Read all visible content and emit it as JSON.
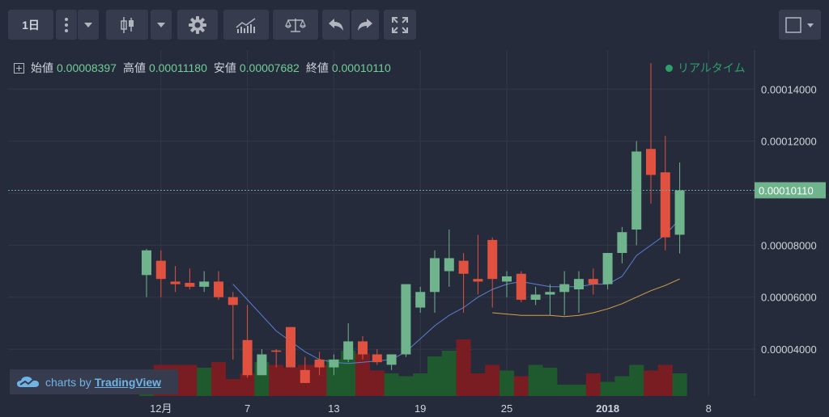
{
  "toolbar": {
    "interval_label": "1日",
    "menu_icon": "vertical-dots-icon",
    "dropdown_icon": "chevron-down-icon",
    "chart_type_icon": "candlestick-icon",
    "settings_icon": "gear-icon",
    "indicators_icon": "indicators-icon",
    "compare_icon": "balance-scale-icon",
    "undo_icon": "undo-arrow-icon",
    "redo_icon": "redo-arrow-icon",
    "fullscreen_icon": "fullscreen-icon",
    "window_icon": "square-icon"
  },
  "legend": {
    "open_label": "始値",
    "open_value": "0.00008397",
    "high_label": "高値",
    "high_value": "0.00011180",
    "low_label": "安値",
    "low_value": "0.00007682",
    "close_label": "終値",
    "close_value": "0.00010110",
    "realtime_label": "リアルタイム"
  },
  "watermark": {
    "prefix": "charts by",
    "brand": "TradingView",
    "icon": "tradingview-cloud-icon"
  },
  "colors": {
    "background": "#262b3b",
    "grid": "#323848",
    "up": "#6fb48c",
    "down": "#e0513f",
    "vol_up": "#1e5a2d",
    "vol_down": "#7a1d22",
    "ma_fast": "#5b7fd1",
    "ma_slow": "#d4a24a",
    "price_tag": "#6fb48c",
    "axis_text": "#d1d4dc"
  },
  "chart_data": {
    "type": "candlestick",
    "title": "",
    "current_price": "0.00010110",
    "ylim": [
      2.2e-05,
      0.000155
    ],
    "y_ticks": [
      "0.00004000",
      "0.00006000",
      "0.00008000",
      "0.00010000",
      "0.00012000",
      "0.00014000"
    ],
    "x_ticks": [
      {
        "index": 1,
        "label": "12月",
        "bold": false
      },
      {
        "index": 7,
        "label": "7",
        "bold": false
      },
      {
        "index": 13,
        "label": "13",
        "bold": false
      },
      {
        "index": 19,
        "label": "19",
        "bold": false
      },
      {
        "index": 25,
        "label": "25",
        "bold": false
      },
      {
        "index": 32,
        "label": "2018",
        "bold": true
      },
      {
        "index": 39,
        "label": "8",
        "bold": false
      }
    ],
    "candles": [
      {
        "o": 6.85e-05,
        "h": 7.85e-05,
        "l": 6e-05,
        "c": 7.8e-05
      },
      {
        "o": 7.4e-05,
        "h": 7.8e-05,
        "l": 6e-05,
        "c": 6.7e-05
      },
      {
        "o": 6.6e-05,
        "h": 7.2e-05,
        "l": 6.2e-05,
        "c": 6.5e-05
      },
      {
        "o": 6.55e-05,
        "h": 7.1e-05,
        "l": 6.3e-05,
        "c": 6.4e-05
      },
      {
        "o": 6.4e-05,
        "h": 7e-05,
        "l": 6.2e-05,
        "c": 6.6e-05
      },
      {
        "o": 6.6e-05,
        "h": 7e-05,
        "l": 5.9e-05,
        "c": 6e-05
      },
      {
        "o": 6e-05,
        "h": 6.2e-05,
        "l": 3.6e-05,
        "c": 5.7e-05
      },
      {
        "o": 4.35e-05,
        "h": 5.7e-05,
        "l": 2.9e-05,
        "c": 3e-05
      },
      {
        "o": 3e-05,
        "h": 4e-05,
        "l": 3e-05,
        "c": 3.8e-05
      },
      {
        "o": 3.95e-05,
        "h": 4e-05,
        "l": 3.3e-05,
        "c": 3.9e-05
      },
      {
        "o": 4.85e-05,
        "h": 4.85e-05,
        "l": 3.3e-05,
        "c": 3.3e-05
      },
      {
        "o": 3.2e-05,
        "h": 3.7e-05,
        "l": 2.7e-05,
        "c": 2.7e-05
      },
      {
        "o": 3.6e-05,
        "h": 3.9e-05,
        "l": 3e-05,
        "c": 3.3e-05
      },
      {
        "o": 3.3e-05,
        "h": 3.8e-05,
        "l": 3e-05,
        "c": 3.6e-05
      },
      {
        "o": 3.6e-05,
        "h": 5e-05,
        "l": 3.5e-05,
        "c": 4.3e-05
      },
      {
        "o": 4.3e-05,
        "h": 4.5e-05,
        "l": 3.6e-05,
        "c": 3.8e-05
      },
      {
        "o": 3.8e-05,
        "h": 4e-05,
        "l": 3.4e-05,
        "c": 3.5e-05
      },
      {
        "o": 3.4e-05,
        "h": 3.8e-05,
        "l": 3.2e-05,
        "c": 3.8e-05
      },
      {
        "o": 3.8e-05,
        "h": 6.5e-05,
        "l": 3.7e-05,
        "c": 6.5e-05
      },
      {
        "o": 5.6e-05,
        "h": 6.4e-05,
        "l": 5.4e-05,
        "c": 6.2e-05
      },
      {
        "o": 6.2e-05,
        "h": 7.8e-05,
        "l": 5.4e-05,
        "c": 7.5e-05
      },
      {
        "o": 7e-05,
        "h": 8.6e-05,
        "l": 6.4e-05,
        "c": 7.5e-05
      },
      {
        "o": 7.4e-05,
        "h": 7.7e-05,
        "l": 5.4e-05,
        "c": 6.9e-05
      },
      {
        "o": 6.7e-05,
        "h": 8.4e-05,
        "l": 6.1e-05,
        "c": 6.6e-05
      },
      {
        "o": 8.2e-05,
        "h": 8.3e-05,
        "l": 5.6e-05,
        "c": 6.7e-05
      },
      {
        "o": 6.6e-05,
        "h": 7e-05,
        "l": 6e-05,
        "c": 6.8e-05
      },
      {
        "o": 6.9e-05,
        "h": 7e-05,
        "l": 5.8e-05,
        "c": 5.9e-05
      },
      {
        "o": 5.9e-05,
        "h": 6.4e-05,
        "l": 5.7e-05,
        "c": 6.1e-05
      },
      {
        "o": 6.1e-05,
        "h": 6.5e-05,
        "l": 5.3e-05,
        "c": 6.2e-05
      },
      {
        "o": 6.2e-05,
        "h": 7e-05,
        "l": 5.3e-05,
        "c": 6.5e-05
      },
      {
        "o": 6.3e-05,
        "h": 7e-05,
        "l": 5.4e-05,
        "c": 6.7e-05
      },
      {
        "o": 6.7e-05,
        "h": 7.1e-05,
        "l": 6.1e-05,
        "c": 6.5e-05
      },
      {
        "o": 6.5e-05,
        "h": 7.7e-05,
        "l": 6.3e-05,
        "c": 7.7e-05
      },
      {
        "o": 7.7e-05,
        "h": 8.7e-05,
        "l": 7.3e-05,
        "c": 8.5e-05
      },
      {
        "o": 8.6e-05,
        "h": 0.00012,
        "l": 8e-05,
        "c": 0.000116
      },
      {
        "o": 0.000117,
        "h": 0.00015,
        "l": 9.6e-05,
        "c": 0.000107
      },
      {
        "o": 0.000108,
        "h": 0.000122,
        "l": 7.8e-05,
        "c": 8.3e-05
      },
      {
        "o": 8.4e-05,
        "h": 0.0001118,
        "l": 7.68e-05,
        "c": 0.0001011
      }
    ],
    "volume_relative": [
      0.45,
      0.55,
      0.55,
      0.55,
      0.5,
      0.6,
      0.3,
      0.4,
      0.6,
      0.55,
      0.5,
      0.55,
      0.55,
      0.65,
      0.8,
      0.75,
      0.45,
      0.4,
      0.35,
      0.4,
      0.7,
      0.8,
      1.0,
      0.4,
      0.55,
      0.45,
      0.35,
      0.55,
      0.5,
      0.2,
      0.2,
      0.4,
      0.25,
      0.35,
      0.55,
      0.45,
      0.55,
      0.4
    ],
    "ma_fast": [
      null,
      null,
      null,
      null,
      null,
      null,
      6.5e-05,
      5.9e-05,
      5.3e-05,
      4.7e-05,
      4.3e-05,
      3.9e-05,
      3.6e-05,
      3.5e-05,
      3.45e-05,
      3.5e-05,
      3.55e-05,
      3.6e-05,
      3.9e-05,
      4.4e-05,
      4.9e-05,
      5.3e-05,
      5.6e-05,
      6e-05,
      6.3e-05,
      6.5e-05,
      6.6e-05,
      6.5e-05,
      6.4e-05,
      6.4e-05,
      6.4e-05,
      6.5e-05,
      6.5e-05,
      6.8e-05,
      7.6e-05,
      8e-05,
      8.4e-05,
      9e-05
    ],
    "ma_slow": [
      null,
      null,
      null,
      null,
      null,
      null,
      null,
      null,
      null,
      null,
      null,
      null,
      null,
      null,
      null,
      null,
      null,
      null,
      null,
      null,
      null,
      null,
      null,
      null,
      5.4e-05,
      5.35e-05,
      5.3e-05,
      5.3e-05,
      5.3e-05,
      5.25e-05,
      5.3e-05,
      5.4e-05,
      5.55e-05,
      5.75e-05,
      6e-05,
      6.25e-05,
      6.45e-05,
      6.7e-05
    ]
  }
}
